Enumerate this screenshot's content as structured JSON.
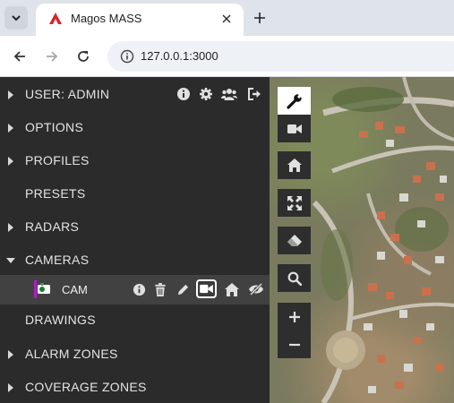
{
  "browser": {
    "tab_title": "Magos MASS",
    "url": "127.0.0.1:3000"
  },
  "sidebar": {
    "user_label": "USER: ADMIN",
    "items": [
      {
        "label": "OPTIONS",
        "caret": "right"
      },
      {
        "label": "PROFILES",
        "caret": "right"
      },
      {
        "label": "PRESETS",
        "caret": "none"
      },
      {
        "label": "RADARS",
        "caret": "right"
      },
      {
        "label": "CAMERAS",
        "caret": "down"
      },
      {
        "label": "DRAWINGS",
        "caret": "none"
      },
      {
        "label": "ALARM ZONES",
        "caret": "right"
      },
      {
        "label": "COVERAGE ZONES",
        "caret": "right"
      }
    ],
    "camera": {
      "label": "CAM",
      "accent_color": "#b01ec8",
      "icons": [
        "info-icon",
        "trash-icon",
        "pencil-icon",
        "video-camera-icon",
        "home-icon",
        "eye-slash-icon"
      ]
    },
    "user_icons": [
      "info-icon",
      "gear-icon",
      "users-icon",
      "logout-icon"
    ]
  },
  "map_tools": {
    "top_group": [
      "wrench-icon",
      "video-camera-icon"
    ],
    "buttons": [
      "home-icon",
      "expand-icon",
      "eraser-icon",
      "search-icon"
    ],
    "zoom": {
      "in": "+",
      "out": "−"
    }
  },
  "colors": {
    "panel_bg": "#2b2b2b",
    "selected_row_bg": "#414141",
    "text": "#e4e4e4",
    "brand_red": "#d9242b"
  }
}
